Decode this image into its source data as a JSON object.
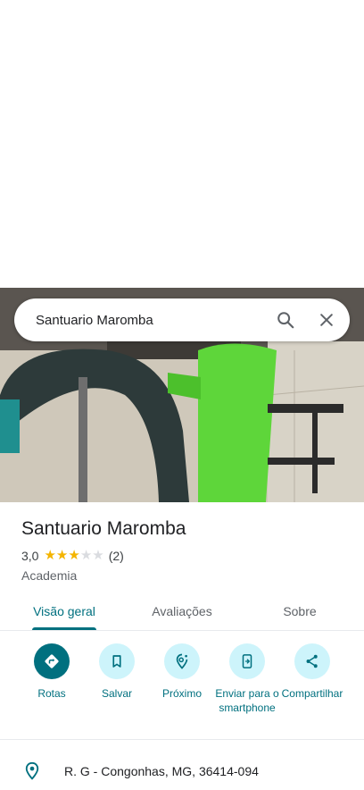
{
  "search": {
    "query": "Santuario Maromba"
  },
  "place": {
    "name": "Santuario Maromba",
    "rating": "3,0",
    "rating_value": 3,
    "rating_max": 5,
    "review_count": "(2)",
    "category": "Academia"
  },
  "tabs": [
    {
      "label": "Visão geral",
      "active": true
    },
    {
      "label": "Avaliações",
      "active": false
    },
    {
      "label": "Sobre",
      "active": false
    }
  ],
  "actions": [
    {
      "label": "Rotas",
      "icon": "directions-icon"
    },
    {
      "label": "Salvar",
      "icon": "bookmark-icon"
    },
    {
      "label": "Próximo",
      "icon": "nearby-icon"
    },
    {
      "label": "Enviar para o smartphone",
      "icon": "send-to-phone-icon"
    },
    {
      "label": "Compartilhar",
      "icon": "share-icon"
    }
  ],
  "address": {
    "text": "R. G - Congonhas, MG, 36414-094",
    "icon": "location-pin-icon"
  },
  "colors": {
    "accent": "#00707f",
    "action_bg": "#cdf4fb",
    "star": "#f4b400"
  }
}
